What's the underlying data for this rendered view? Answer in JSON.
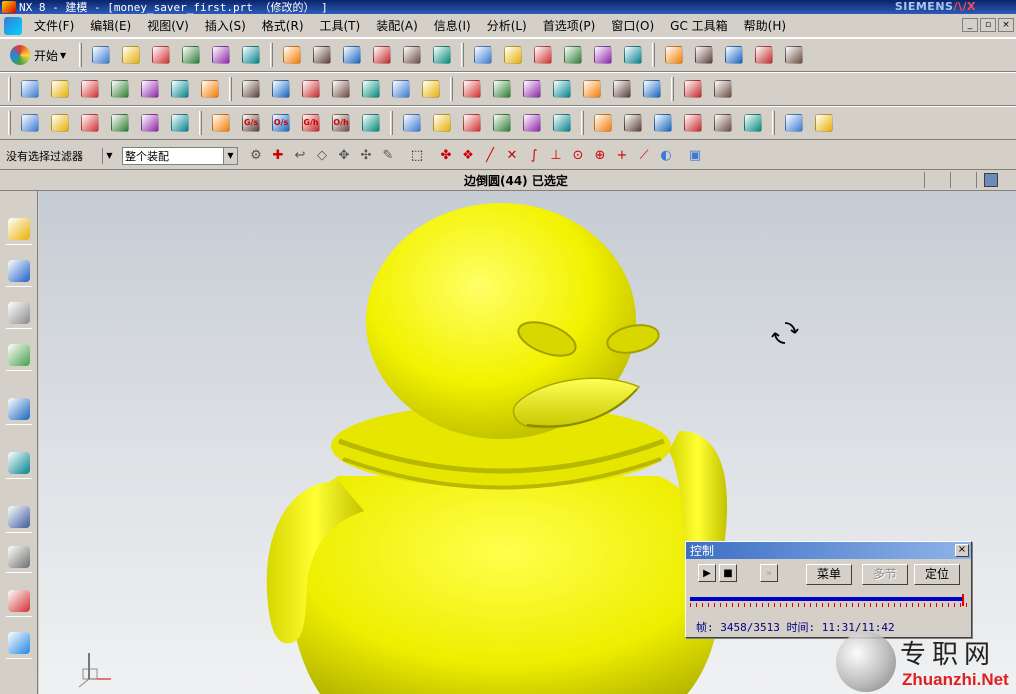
{
  "window": {
    "title": "NX 8 - 建模 - [money_saver_first.prt （修改的） ]",
    "brand_left": "SIEMENS",
    "brand_right": "/\\/X",
    "controls": [
      "_",
      "▫",
      "×"
    ]
  },
  "menu": {
    "items": [
      "文件(F)",
      "编辑(E)",
      "视图(V)",
      "插入(S)",
      "格式(R)",
      "工具(T)",
      "装配(A)",
      "信息(I)",
      "分析(L)",
      "首选项(P)",
      "窗口(O)",
      "GC 工具箱",
      "帮助(H)"
    ]
  },
  "toolbar": {
    "start_label": "开始",
    "row1_icons": [
      "new-file-icon",
      "open-folder-icon",
      "save-icon",
      "cut-icon",
      "copy-icon",
      "paste-icon",
      "undo-icon",
      "select-tool-icon",
      "print-icon",
      "shaded-cube-icon",
      "render-style-icon",
      "section-cube-icon",
      "hide-cube-icon",
      "window-icon",
      "move-part-icon",
      "replace-icon",
      "layer-icon",
      "wcs-icon",
      "measure-icon",
      "distance-icon",
      "pin-icon",
      "tape-icon",
      "angle-icon"
    ],
    "row2_icons": [
      "sketch-icon",
      "extrude-icon",
      "revolve-icon",
      "block-icon",
      "edge-blend-icon",
      "chamfer-icon",
      "hole-icon",
      "boolean-icon",
      "trim-body-icon",
      "shell-icon",
      "draft-icon",
      "thicken-icon",
      "mirror-icon",
      "pattern-icon",
      "sweep-icon",
      "offset-face-icon",
      "surface-icon",
      "mesh-icon",
      "face-blend-icon",
      "sew-icon",
      "studio-icon",
      "x-form-icon",
      "curve-network-icon"
    ],
    "row3_icons": [
      "datum-icon",
      "stack-icon",
      "list-icon",
      "tag-icon",
      "assembly-icon",
      "constraint-icon",
      "component-icon",
      "surface-a-icon",
      "surface-b-icon",
      "surface-c-icon",
      "surface-d-icon",
      "surface-e-icon",
      "cylinder-icon",
      "spring-icon",
      "hatch-icon",
      "check-icon",
      "table-icon",
      "grid-icon",
      "axis-icon",
      "first-frame-icon",
      "prev-frame-icon",
      "next-frame-icon",
      "last-frame-icon",
      "record-icon",
      "lightning-icon",
      "refresh-icon"
    ],
    "surface_labels": [
      "G/s",
      "O/s",
      "G/h",
      "O/h"
    ]
  },
  "filterbar": {
    "filter_value": "没有选择过滤器",
    "scope_value": "整个装配"
  },
  "status": {
    "message": "边倒圆(44) 已选定"
  },
  "leftbar": {
    "icons": [
      "assembly-navigator-icon",
      "constraint-navigator-icon",
      "part-navigator-icon",
      "reuse-library-icon",
      "info-window-icon",
      "web-browser-icon",
      "history-clock-icon",
      "system-materials-icon",
      "palette-icon",
      "roles-icon"
    ]
  },
  "dialog": {
    "title": "控制",
    "close": "×",
    "play": "▶",
    "stop": "■",
    "step": "»",
    "menu_label": "菜单",
    "multi_label": "多节",
    "position_label": "定位",
    "frame_label": "帧:",
    "frame_current": 3458,
    "frame_total": 3513,
    "time_label": "时间:",
    "time_current": "11:31",
    "time_total": "11:42"
  },
  "watermark": {
    "cn": "专职网",
    "en": "Zhuanzhi.Net"
  },
  "colors": {
    "model_yellow": "#ffff00",
    "model_shadow": "#9a9a00",
    "timeline_blue": "#0000c8",
    "timeline_red": "#e00000"
  }
}
